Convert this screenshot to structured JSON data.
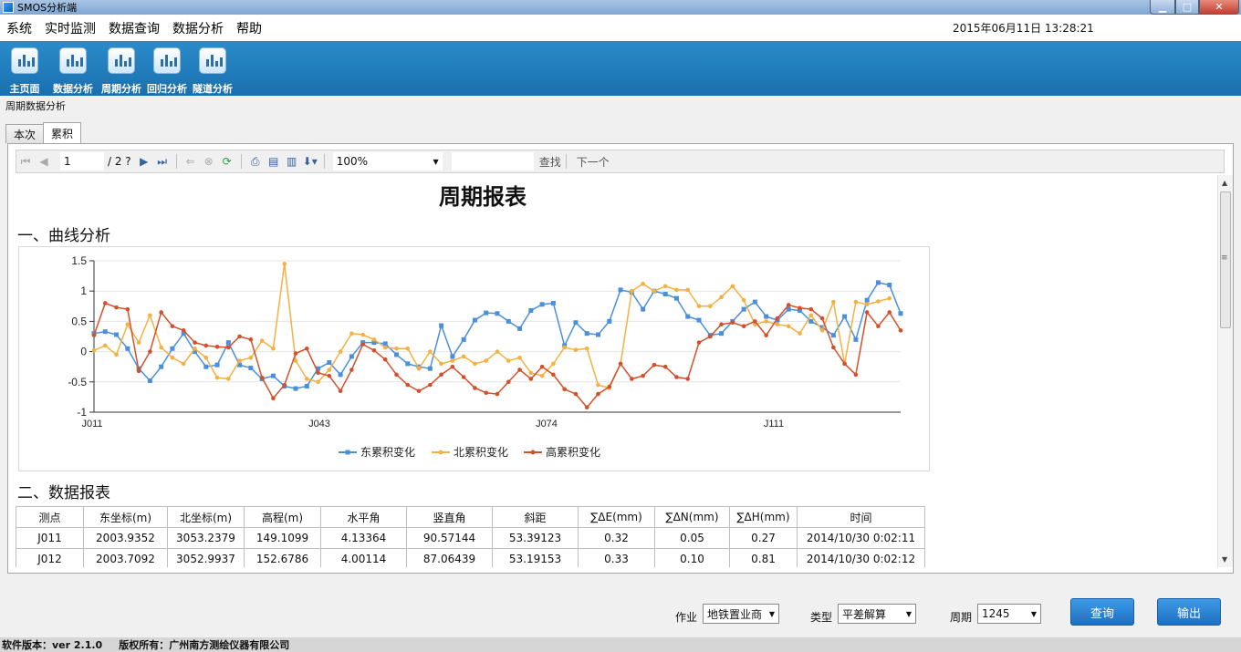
{
  "window": {
    "title": "SMOS分析端",
    "min": "▁",
    "max": "□",
    "close": "✕"
  },
  "menu": {
    "items": [
      "系统",
      "实时监测",
      "数据查询",
      "数据分析",
      "帮助"
    ],
    "datetime": "2015年06月11日 13:28:21"
  },
  "toolbar": {
    "buttons": [
      {
        "label": "主页面",
        "icon": "chart-icon"
      },
      {
        "label": "数据分析",
        "icon": "chart-icon"
      },
      {
        "label": "周期分析",
        "icon": "chart-icon"
      },
      {
        "label": "回归分析",
        "icon": "chart-icon"
      },
      {
        "label": "隧道分析",
        "icon": "chart-icon"
      }
    ]
  },
  "section_label": "周期数据分析",
  "tabs": [
    {
      "label": "本次",
      "active": false
    },
    {
      "label": "累积",
      "active": true
    }
  ],
  "viewer": {
    "page": "1",
    "page_count": "/ 2 ?",
    "zoom": "100%",
    "find": "查找",
    "next": "下一个"
  },
  "report": {
    "title": "周期报表",
    "section1": "一、曲线分析",
    "section2": "二、数据报表",
    "table": {
      "headers": [
        "测点",
        "东坐标(m)",
        "北坐标(m)",
        "高程(m)",
        "水平角",
        "竖直角",
        "斜距",
        "∑ΔE(mm)",
        "∑ΔN(mm)",
        "∑ΔH(mm)",
        "时间"
      ],
      "rows": [
        [
          "J011",
          "2003.9352",
          "3053.2379",
          "149.1099",
          "4.13364",
          "90.57144",
          "53.39123",
          "0.32",
          "0.05",
          "0.27",
          "2014/10/30 0:02:11"
        ],
        [
          "J012",
          "2003.7092",
          "3052.9937",
          "152.6786",
          "4.00114",
          "87.06439",
          "53.19153",
          "0.33",
          "0.10",
          "0.81",
          "2014/10/30 0:02:12"
        ]
      ]
    }
  },
  "chart_data": {
    "type": "line",
    "x_tick_labels": [
      "J011",
      "J043",
      "J074",
      "J111"
    ],
    "ylim": [
      -1,
      1.5
    ],
    "yticks": [
      -1,
      -0.5,
      0,
      0.5,
      1,
      1.5
    ],
    "legend_position": "bottom",
    "grid": true,
    "series": [
      {
        "name": "东累积变化",
        "color": "#4a8fdc",
        "marker": "square",
        "values": [
          0.3,
          0.33,
          0.28,
          0.05,
          -0.28,
          -0.48,
          -0.25,
          0.05,
          0.3,
          0,
          -0.25,
          -0.22,
          0.15,
          -0.22,
          -0.27,
          -0.45,
          -0.4,
          -0.57,
          -0.61,
          -0.57,
          -0.28,
          -0.18,
          -0.38,
          -0.08,
          0.15,
          0.15,
          0.13,
          -0.05,
          -0.2,
          -0.25,
          -0.28,
          0.43,
          -0.08,
          0.2,
          0.52,
          0.64,
          0.63,
          0.5,
          0.38,
          0.68,
          0.78,
          0.8,
          0.1,
          0.48,
          0.3,
          0.28,
          0.5,
          1.02,
          0.98,
          0.7,
          1,
          0.95,
          0.88,
          0.58,
          0.52,
          0.27,
          0.3,
          0.5,
          0.7,
          0.82,
          0.58,
          0.52,
          0.7,
          0.68,
          0.5,
          0.4,
          0.27,
          0.58,
          0.2,
          0.85,
          1.14,
          1.1,
          0.63
        ]
      },
      {
        "name": "北累积变化",
        "color": "#f5b041",
        "marker": "circle",
        "values": [
          0.02,
          0.1,
          -0.05,
          0.45,
          0.15,
          0.6,
          0.07,
          -0.1,
          -0.2,
          0.05,
          -0.1,
          -0.43,
          -0.45,
          -0.15,
          -0.1,
          0.18,
          0.05,
          1.45,
          -0.15,
          -0.45,
          -0.5,
          -0.3,
          0,
          0.3,
          0.28,
          0.2,
          0.07,
          0.05,
          0.05,
          -0.28,
          0,
          -0.2,
          -0.15,
          -0.08,
          -0.2,
          -0.15,
          0,
          -0.15,
          -0.1,
          -0.35,
          -0.4,
          -0.2,
          0.07,
          0.03,
          0.05,
          -0.55,
          -0.6,
          -0.2,
          1,
          1.12,
          1.0,
          1.08,
          1.02,
          1.02,
          0.75,
          0.75,
          0.9,
          1.08,
          0.85,
          0.45,
          0.5,
          0.45,
          0.42,
          0.3,
          0.6,
          0.35,
          0.82,
          -0.2,
          0.82,
          0.78,
          0.83,
          0.88
        ]
      },
      {
        "name": "高累积变化",
        "color": "#d4502a",
        "marker": "circle",
        "values": [
          0.27,
          0.8,
          0.73,
          0.7,
          -0.32,
          0,
          0.65,
          0.42,
          0.35,
          0.15,
          0.1,
          0.08,
          0.07,
          0.25,
          0.2,
          -0.43,
          -0.77,
          -0.55,
          -0.03,
          0.05,
          -0.35,
          -0.4,
          -0.65,
          -0.3,
          0.12,
          0.02,
          -0.13,
          -0.38,
          -0.55,
          -0.65,
          -0.55,
          -0.38,
          -0.25,
          -0.42,
          -0.6,
          -0.68,
          -0.7,
          -0.5,
          -0.3,
          -0.45,
          -0.25,
          -0.38,
          -0.62,
          -0.7,
          -0.92,
          -0.7,
          -0.58,
          -0.2,
          -0.45,
          -0.4,
          -0.22,
          -0.25,
          -0.42,
          -0.45,
          0.15,
          0.25,
          0.45,
          0.48,
          0.42,
          0.5,
          0.27,
          0.55,
          0.77,
          0.72,
          0.7,
          0.55,
          0.07,
          -0.2,
          -0.38,
          0.65,
          0.42,
          0.65,
          0.35
        ]
      }
    ]
  },
  "filters": {
    "job_label": "作业",
    "job_value": "地铁置业商",
    "type_label": "类型",
    "type_value": "平差解算",
    "period_label": "周期",
    "period_value": "1245",
    "query_btn": "查询",
    "export_btn": "输出"
  },
  "status": {
    "version": "软件版本：ver 2.1.0",
    "copyright": "版权所有：广州南方测绘仪器有限公司"
  }
}
